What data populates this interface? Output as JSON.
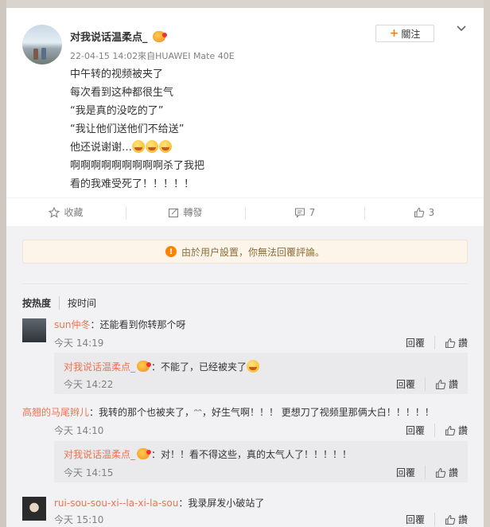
{
  "post": {
    "author": "对我说话温柔点_",
    "meta": "22-04-15 14:02來自HUAWEI Mate 40E",
    "follow_label": "關注",
    "lines": [
      "中午转的视频被夹了",
      "每次看到这种都很生气",
      "“我是真的没吃的了”",
      "“我让他们送他们不给送”",
      "他还说谢谢…",
      "啊啊啊啊啊啊啊啊啊杀了我把",
      "看的我难受死了！！！！！"
    ]
  },
  "actions": {
    "favorite": "收藏",
    "repost": "轉發",
    "comments": "7",
    "likes": "3"
  },
  "notice": "由於用户設置，你無法回覆評論。",
  "sort": {
    "hot": "按热度",
    "time": "按时间"
  },
  "comments": [
    {
      "user": "sun仲冬",
      "text": "：还能看到你转那个呀",
      "time": "今天 14:19",
      "reply_label": "回覆",
      "like_label": "讚",
      "reply": {
        "user": "对我说话温柔点_",
        "text": "：不能了，已经被夹了",
        "time": "今天 14:22",
        "reply_label": "回覆",
        "like_label": "讚"
      }
    },
    {
      "user": "高翘的马尾辫儿",
      "text": "：我转的那个也被夹了，ᵔᵔ，好生气啊！！！ 更想刀了视频里那俩大白！！！！！",
      "time": "今天 14:10",
      "reply_label": "回覆",
      "like_label": "讚",
      "reply": {
        "user": "对我说话温柔点_",
        "text": "：对！！看不得这些，真的太气人了！！！！！",
        "time": "今天 14:15",
        "reply_label": "回覆",
        "like_label": "讚"
      }
    },
    {
      "user": "rui-sou-sou-xi--la-xi-la-sou",
      "text": "：我录屏发小破站了",
      "time": "今天 15:10",
      "reply_label": "回覆",
      "like_label": "讚"
    }
  ]
}
